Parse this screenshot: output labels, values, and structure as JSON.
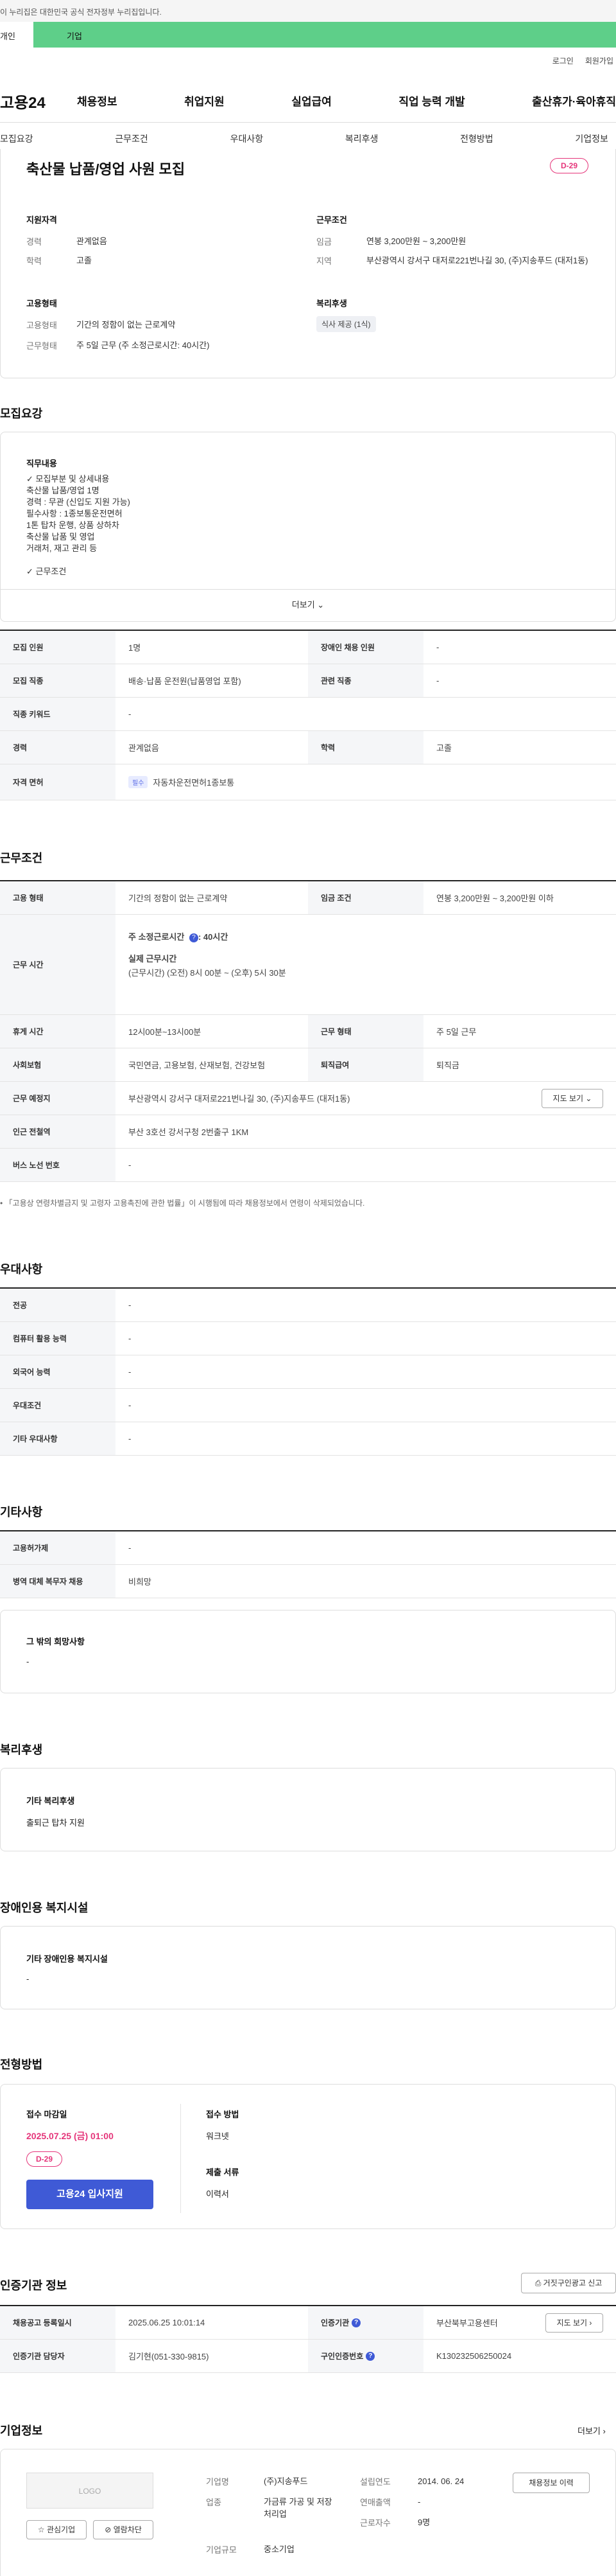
{
  "gov_banner": "이 누리집은 대한민국 공식 전자정부 누리집입니다.",
  "tabs": {
    "individual": "개인",
    "company": "기업"
  },
  "util": {
    "login": "로그인",
    "join": "회원가입"
  },
  "logo": "고용24",
  "gnb": [
    "채용정보",
    "취업지원",
    "실업급여",
    "직업 능력 개발",
    "출산휴가·육아휴직"
  ],
  "subnav": [
    "모집요강",
    "근무조건",
    "우대사항",
    "복리후생",
    "전형방법",
    "기업정보"
  ],
  "summary": {
    "title": "축산물 납품/영업 사원 모집",
    "dday": "D-29",
    "qual_h": "지원자격",
    "career_k": "경력",
    "career_v": "관계없음",
    "edu_k": "학력",
    "edu_v": "고졸",
    "cond_h": "근무조건",
    "wage_k": "임금",
    "wage_v": "연봉 3,200만원 ~ 3,200만원",
    "region_k": "지역",
    "region_v": "부산광역시 강서구 대저로221번나길 30, (주)지송푸드 (대저1동)",
    "emp_h": "고용형태",
    "emptype_k": "고용형태",
    "emptype_v": "기간의 정함이 없는 근로계약",
    "worktype_k": "근무형태",
    "worktype_v": "주 5일 근무 (주 소정근로시간: 40시간)",
    "welfare_h": "복리후생",
    "welfare_chip": "식사 제공 (1식)"
  },
  "recruit": {
    "heading": "모집요강",
    "duty_h": "직무내용",
    "duty_lines": [
      "✓ 모집부분 및 상세내용",
      "축산물 납품/영업 1명",
      "경력 : 무관 (신입도 지원 가능)",
      "필수사항 : 1종보통운전면허",
      "1톤 탑차 운행, 상품 상하차",
      "축산물 납품 및 영업",
      "거래처, 재고 관리 등",
      "",
      "✓ 근무조건"
    ],
    "more": "더보기",
    "r1": {
      "k1": "모집 인원",
      "v1": "1명",
      "k2": "장애인 채용 인원",
      "v2": "-"
    },
    "r2": {
      "k1": "모집 직종",
      "v1": "배송·납품 운전원(납품영업 포함)",
      "k2": "관련 직종",
      "v2": "-"
    },
    "r3": {
      "k1": "직종 키워드",
      "v1": "-"
    },
    "r4": {
      "k1": "경력",
      "v1": "관계없음",
      "k2": "학력",
      "v2": "고졸"
    },
    "r5": {
      "k1": "자격 면허",
      "req": "필수",
      "v1": "자동차운전면허1종보통"
    }
  },
  "cond": {
    "heading": "근무조건",
    "r1": {
      "k1": "고용 형태",
      "v1": "기간의 정함이 없는 근로계약",
      "k2": "임금 조건",
      "v2": "연봉 3,200만원 ~ 3,200만원 이하"
    },
    "r2": {
      "k1": "근무 시간",
      "l1": "주 소정근로시간",
      "l1v": ": 40시간",
      "l2": "실제 근무시간",
      "l3": "(근무시간) (오전) 8시 00분 ~ (오후) 5시 30분"
    },
    "r3": {
      "k1": "휴게 시간",
      "v1": "12시00분~13시00분",
      "k2": "근무 형태",
      "v2": "주 5일 근무"
    },
    "r4": {
      "k1": "사회보험",
      "v1": "국민연금, 고용보험, 산재보험, 건강보험",
      "k2": "퇴직급여",
      "v2": "퇴직금"
    },
    "r5": {
      "k1": "근무 예정지",
      "v1": "부산광역시 강서구 대저로221번나길 30, (주)지송푸드 (대저1동)",
      "btn": "지도 보기"
    },
    "r6": {
      "k1": "인근 전철역",
      "v1": "부산 3호선 강서구청 2번출구 1KM"
    },
    "r7": {
      "k1": "버스 노선 번호",
      "v1": "-"
    },
    "note": "「고용상 연령차별금지 및 고령자 고용촉진에 관한 법률」이 시행됨에 따라 채용정보에서 연령이 삭제되었습니다."
  },
  "pref": {
    "heading": "우대사항",
    "rows": [
      {
        "k": "전공",
        "v": "-"
      },
      {
        "k": "컴퓨터 활용 능력",
        "v": "-"
      },
      {
        "k": "외국어 능력",
        "v": "-"
      },
      {
        "k": "우대조건",
        "v": "-"
      },
      {
        "k": "기타 우대사항",
        "v": "-"
      }
    ]
  },
  "etc": {
    "heading": "기타사항",
    "rows": [
      {
        "k": "고용허가제",
        "v": "-"
      },
      {
        "k": "병역 대체 복무자 채용",
        "v": "비희망"
      }
    ],
    "other_h": "그 밖의 희망사항",
    "other_v": "-"
  },
  "welfare": {
    "heading": "복리후생",
    "h": "기타 복리후생",
    "v": "출퇴근 탑차 지원"
  },
  "disab": {
    "heading": "장애인용 복지시설",
    "h": "기타 장애인용 복지시설",
    "v": "-"
  },
  "process": {
    "heading": "전형방법",
    "deadline_h": "접수 마감일",
    "deadline_v": "2025.07.25 (금) 01:00",
    "dday": "D-29",
    "apply_btn": "고용24 입사지원",
    "method_h": "접수 방법",
    "method_v": "워크넷",
    "docs_h": "제출 서류",
    "docs_v": "이력서"
  },
  "auth": {
    "heading": "인증기관 정보",
    "report_btn": "거짓구인광고 신고",
    "r1": {
      "k1": "채용공고 등록일시",
      "v1": "2025.06.25 10:01:14",
      "k2": "인증기관",
      "v2": "부산북부고용센터",
      "btn": "지도 보기"
    },
    "r2": {
      "k1": "인증기관 담당자",
      "v1": "김기현(051-330-9815)",
      "k2": "구인인증번호",
      "v2": "K130232506250024"
    }
  },
  "company": {
    "heading": "기업정보",
    "more": "더보기",
    "logo": "LOGO",
    "fav": "관심기업",
    "block": "열람차단",
    "name_k": "기업명",
    "name_v": "(주)지송푸드",
    "ind_k": "업종",
    "ind_v": "가금류 가공 및 저장 처리업",
    "size_k": "기업규모",
    "size_v": "중소기업",
    "est_k": "설립연도",
    "est_v": "2014. 06. 24",
    "sales_k": "연매출액",
    "sales_v": "-",
    "emp_k": "근로자수",
    "emp_v": "9명",
    "jobs_btn": "채용정보 이력"
  }
}
